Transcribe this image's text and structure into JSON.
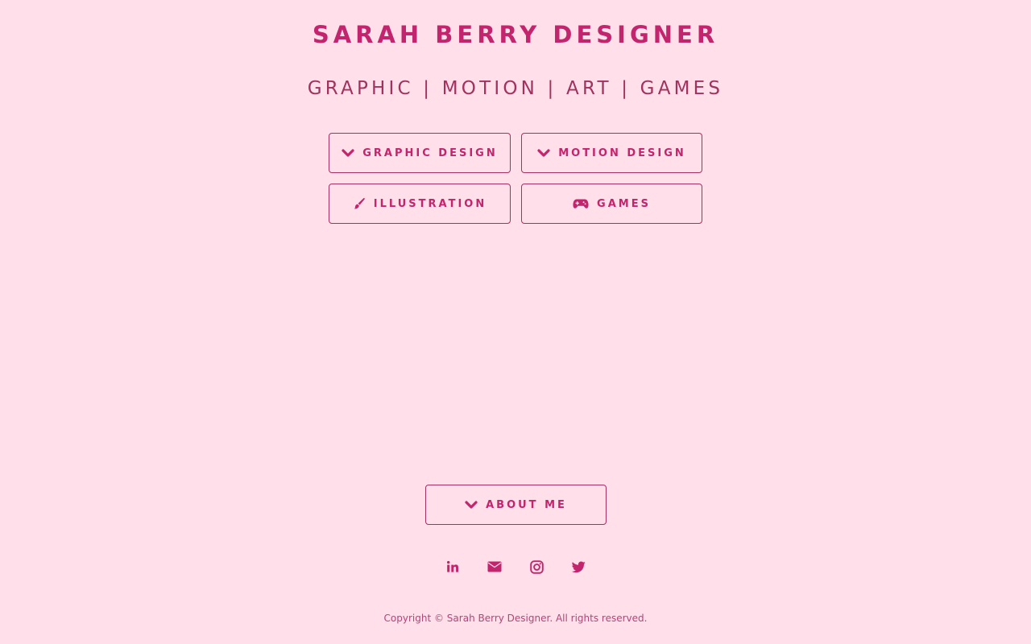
{
  "header": {
    "title": "SARAH BERRY DESIGNER",
    "subtitle": "GRAPHIC | MOTION | ART | GAMES"
  },
  "nav": {
    "graphic_design": {
      "label": "GRAPHIC DESIGN",
      "icon": "chevron-down-icon"
    },
    "motion_design": {
      "label": "MOTION DESIGN",
      "icon": "chevron-down-icon"
    },
    "illustration": {
      "label": "ILLUSTRATION",
      "icon": "paintbrush-icon"
    },
    "games": {
      "label": "GAMES",
      "icon": "gamepad-icon"
    }
  },
  "about": {
    "label": "ABOUT ME",
    "icon": "chevron-down-icon"
  },
  "social": [
    "linkedin-icon",
    "envelope-icon",
    "instagram-icon",
    "twitter-icon"
  ],
  "footer": {
    "copyright": "Copyright © Sarah Berry Designer. All rights reserved."
  },
  "colors": {
    "background": "#ffdfe9",
    "accent": "#c2246e",
    "border": "#a53063"
  }
}
